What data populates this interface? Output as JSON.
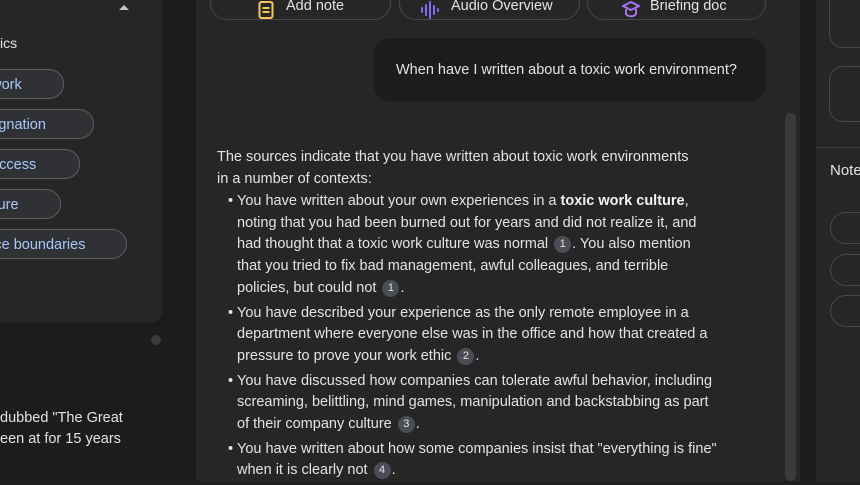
{
  "left_panel": {
    "section_label": "ics",
    "chips": [
      {
        "label": "te work"
      },
      {
        "label": "resignation"
      },
      {
        "label": "r success"
      },
      {
        "label": "culture"
      },
      {
        "label": "place boundaries"
      }
    ],
    "snippet_lines": [
      "dubbed \"The Great",
      "een at for 15 years"
    ]
  },
  "toolbar": {
    "add_note_label": "Add note",
    "audio_overview_label": "Audio Overview",
    "briefing_doc_label": "Briefing doc"
  },
  "chat": {
    "user_message": "When have I written about a toxic work environment?",
    "answer_intro_1": "The sources indicate that you have written about toxic work environments",
    "answer_intro_2": "in a number of contexts:",
    "bullets": [
      {
        "a": "You have written about your own experiences in a ",
        "bold": "toxic work culture",
        "b": ", noting that you had been burned out for years and did not realize it, and had thought that a toxic work culture was normal ",
        "cite1": "1",
        "c": ". You also mention that you tried to fix bad management, awful colleagues, and terrible policies, but could not ",
        "cite2": "1",
        "d": "."
      },
      {
        "a": "You have described your experience as the only remote employee in a department where everyone else was in the office and how that created a pressure to prove your work ethic ",
        "cite1": "2",
        "b": "."
      },
      {
        "a": "You have discussed how companies can tolerate awful behavior, including screaming, belittling, mind games, manipulation and backstabbing as part of their company culture ",
        "cite1": "3",
        "b": "."
      },
      {
        "a": "You have written about how some companies insist that \"everything is fine\" when it is clearly not ",
        "cite1": "4",
        "b": "."
      }
    ]
  },
  "right_panel": {
    "notes_label": "Note"
  },
  "colors": {
    "background": "#1f1f1f",
    "panel": "#262626",
    "chip_text": "#a8c7fa",
    "add_note_icon": "#f6c65b",
    "audio_icon": "#7c6cf2",
    "briefing_icon": "#a872f0"
  },
  "icons": {
    "chevron": "chevron-up-icon",
    "add_note": "note-icon",
    "audio": "waveform-icon",
    "briefing": "briefing-icon"
  }
}
